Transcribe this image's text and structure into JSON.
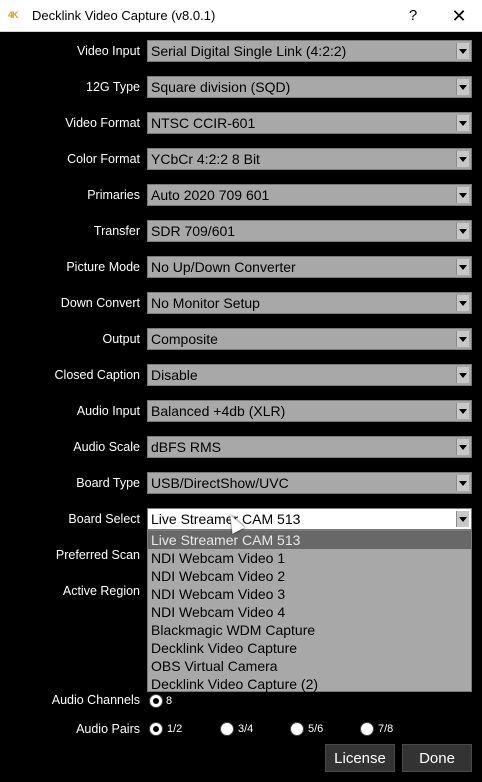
{
  "window": {
    "icon_text": "4K",
    "title": "Decklink Video Capture (v8.0.1)",
    "help_symbol": "?",
    "close_symbol": "✕"
  },
  "settings": [
    {
      "label": "Video Input",
      "value": "Serial Digital Single Link (4:2:2)"
    },
    {
      "label": "12G Type",
      "value": "Square division (SQD)"
    },
    {
      "label": "Video Format",
      "value": "NTSC CCIR-601"
    },
    {
      "label": "Color Format",
      "value": "YCbCr 4:2:2 8 Bit"
    },
    {
      "label": "Primaries",
      "value": "Auto 2020 709 601"
    },
    {
      "label": "Transfer",
      "value": "SDR 709/601"
    },
    {
      "label": "Picture Mode",
      "value": "No Up/Down Converter"
    },
    {
      "label": "Down Convert",
      "value": "No Monitor Setup"
    },
    {
      "label": "Output",
      "value": "Composite"
    },
    {
      "label": "Closed Caption",
      "value": "Disable"
    },
    {
      "label": "Audio Input",
      "value": "Balanced +4db (XLR)"
    },
    {
      "label": "Audio Scale",
      "value": "dBFS RMS"
    },
    {
      "label": "Board Type",
      "value": "USB/DirectShow/UVC"
    },
    {
      "label": "Board Select",
      "value": "Live Streamer CAM 513"
    }
  ],
  "hidden_labels": {
    "preferred_scan": "Preferred Scan",
    "active_region": "Active Region"
  },
  "board_select_options": [
    "Live Streamer CAM 513",
    "NDI Webcam Video 1",
    "NDI Webcam Video 2",
    "NDI Webcam Video 3",
    "NDI Webcam Video 4",
    "Blackmagic WDM Capture",
    "Decklink Video Capture",
    "OBS Virtual Camera",
    "Decklink Video Capture (2)"
  ],
  "audio_channels": {
    "label": "Audio Channels",
    "option": "8"
  },
  "audio_pairs": {
    "label": "Audio Pairs",
    "options": [
      "1/2",
      "3/4",
      "5/6",
      "7/8"
    ],
    "selected": "1/2"
  },
  "buttons": {
    "license": "License",
    "done": "Done"
  }
}
